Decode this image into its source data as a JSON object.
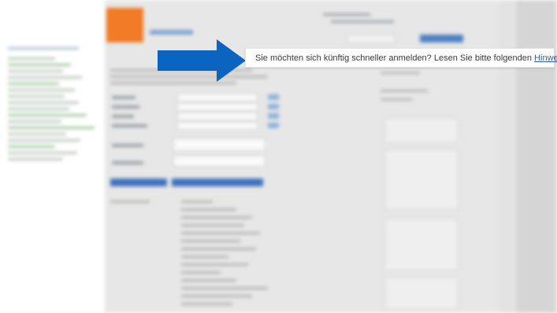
{
  "hint": {
    "message": "Sie möchten sich künftig schneller anmelden? Lesen Sie bitte folgenden ",
    "link_label": "Hinweis"
  },
  "colors": {
    "arrow": "#0b64c0",
    "brand_orange": "#f07a26",
    "link": "#2a5db0"
  }
}
